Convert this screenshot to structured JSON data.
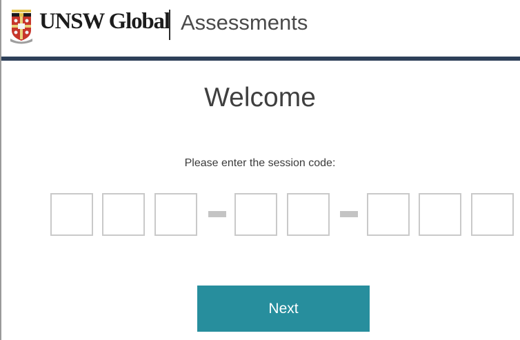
{
  "header": {
    "brand_name": "UNSW Global",
    "app_title": "Assessments",
    "crest_icon": "university-crest-icon",
    "rule_color": "#2e4059"
  },
  "main": {
    "heading": "Welcome",
    "prompt": "Please enter the session code:",
    "session_code": {
      "groups": [
        3,
        2,
        3
      ],
      "values": [
        "",
        "",
        "",
        "",
        "",
        "",
        "",
        ""
      ]
    },
    "next_label": "Next",
    "accent_color": "#278e9d"
  }
}
